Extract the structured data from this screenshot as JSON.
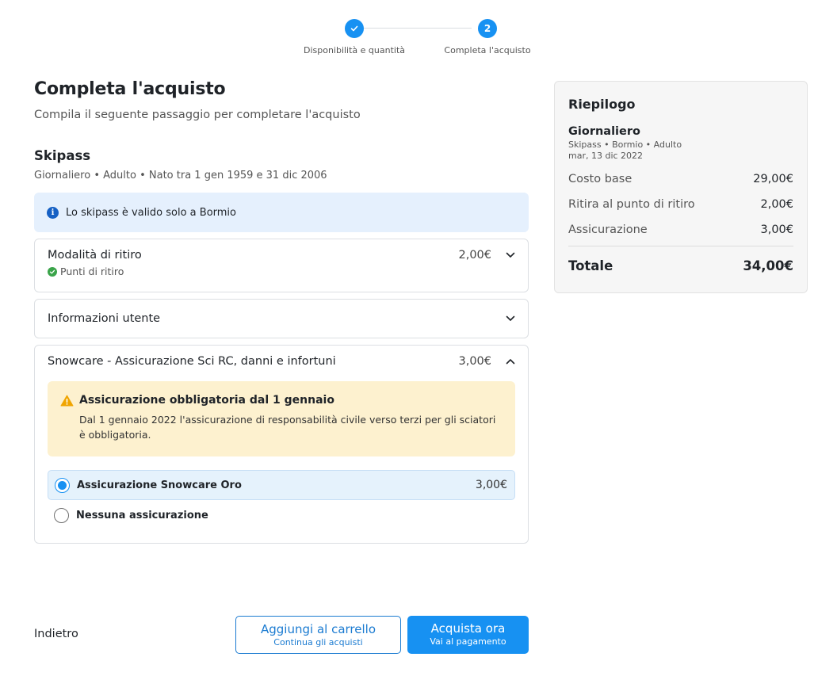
{
  "stepper": {
    "steps": [
      {
        "label": "Disponibilità e quantità",
        "marker": "check-icon"
      },
      {
        "label": "Completa l'acquisto",
        "marker": "2"
      }
    ]
  },
  "main": {
    "title": "Completa l'acquisto",
    "subtitle": "Compila il seguente passaggio per completare l'acquisto",
    "section_title": "Skipass",
    "section_sub": "Giornaliero • Adulto • Nato tra 1 gen 1959 e 31 dic 2006",
    "info_banner": "Lo skipass è valido solo a Bormio",
    "pickup": {
      "title": "Modalità di ritiro",
      "price": "2,00€",
      "selected": "Punti di ritiro"
    },
    "user_info": {
      "title": "Informazioni utente"
    },
    "insurance": {
      "title": "Snowcare - Assicurazione Sci RC, danni e infortuni",
      "price": "3,00€",
      "warning_title": "Assicurazione obbligatoria dal 1 gennaio",
      "warning_text": "Dal 1 gennaio 2022 l'assicurazione di responsabilità civile verso terzi per gli sciatori è obbligatoria.",
      "options": [
        {
          "label": "Assicurazione Snowcare Oro",
          "price": "3,00€",
          "selected": true
        },
        {
          "label": "Nessuna assicurazione",
          "price": "",
          "selected": false
        }
      ]
    }
  },
  "footer": {
    "back_label": "Indietro",
    "add_to_cart_label": "Aggiungi al carrello",
    "add_to_cart_sub": "Continua gli acquisti",
    "buy_now_label": "Acquista ora",
    "buy_now_sub": "Vai al pagamento"
  },
  "summary": {
    "title": "Riepilogo",
    "product_name": "Giornaliero",
    "product_meta": "Skipass • Bormio • Adulto",
    "product_date": "mar, 13 dic 2022",
    "rows": [
      {
        "label": "Costo base",
        "value": "29,00€"
      },
      {
        "label": "Ritira al punto di ritiro",
        "value": "2,00€"
      },
      {
        "label": "Assicurazione",
        "value": "3,00€"
      }
    ],
    "total_label": "Totale",
    "total_value": "34,00€"
  },
  "colors": {
    "accent": "#1791f2",
    "info_bg": "#e5f0fd",
    "warning_bg": "#fdf1cf",
    "success": "#3aa44a"
  }
}
